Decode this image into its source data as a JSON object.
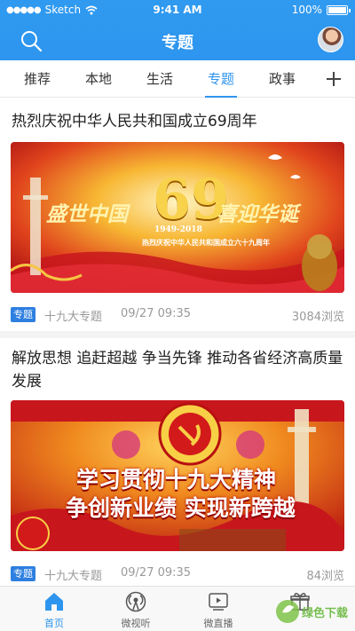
{
  "status_bar": {
    "carrier": "Sketch",
    "time": "9:41 AM",
    "battery": "100%"
  },
  "header": {
    "title": "专题"
  },
  "tabs": [
    {
      "label": "推荐",
      "active": false
    },
    {
      "label": "本地",
      "active": false
    },
    {
      "label": "生活",
      "active": false
    },
    {
      "label": "专题",
      "active": true
    },
    {
      "label": "政事",
      "active": false
    }
  ],
  "articles": [
    {
      "title": "热烈庆祝中华人民共和国成立69周年",
      "banner": {
        "headline_left": "盛世中国",
        "headline_number": "69",
        "headline_right": "喜迎华诞",
        "years": "1949-2018",
        "subline": "热烈庆祝中华人民共和国成立六十九周年"
      },
      "tag": "专题",
      "source": "十九大专题",
      "date": "09/27 09:35",
      "views": "3084浏览"
    },
    {
      "title": "解放思想 追赶超越 争当先锋 推动各省经济高质量发展",
      "banner": {
        "line1": "学习贯彻十九大精神",
        "line2": "争创新业绩 实现新跨越"
      },
      "tag": "专题",
      "source": "十九大专题",
      "date": "09/27 09:35",
      "views": "84浏览"
    }
  ],
  "bottom_nav": [
    {
      "label": "首页",
      "icon": "home-icon",
      "active": true
    },
    {
      "label": "微视听",
      "icon": "broadcast-icon",
      "active": false
    },
    {
      "label": "微直播",
      "icon": "live-video-icon",
      "active": false
    },
    {
      "label": "",
      "icon": "gift-icon",
      "active": false
    }
  ],
  "watermark": {
    "text": "绿色下载"
  },
  "colors": {
    "accent": "#2e95ee",
    "tag": "#2e7fe0",
    "banner_red": "#c8161d",
    "banner_gold": "#f5c542"
  }
}
